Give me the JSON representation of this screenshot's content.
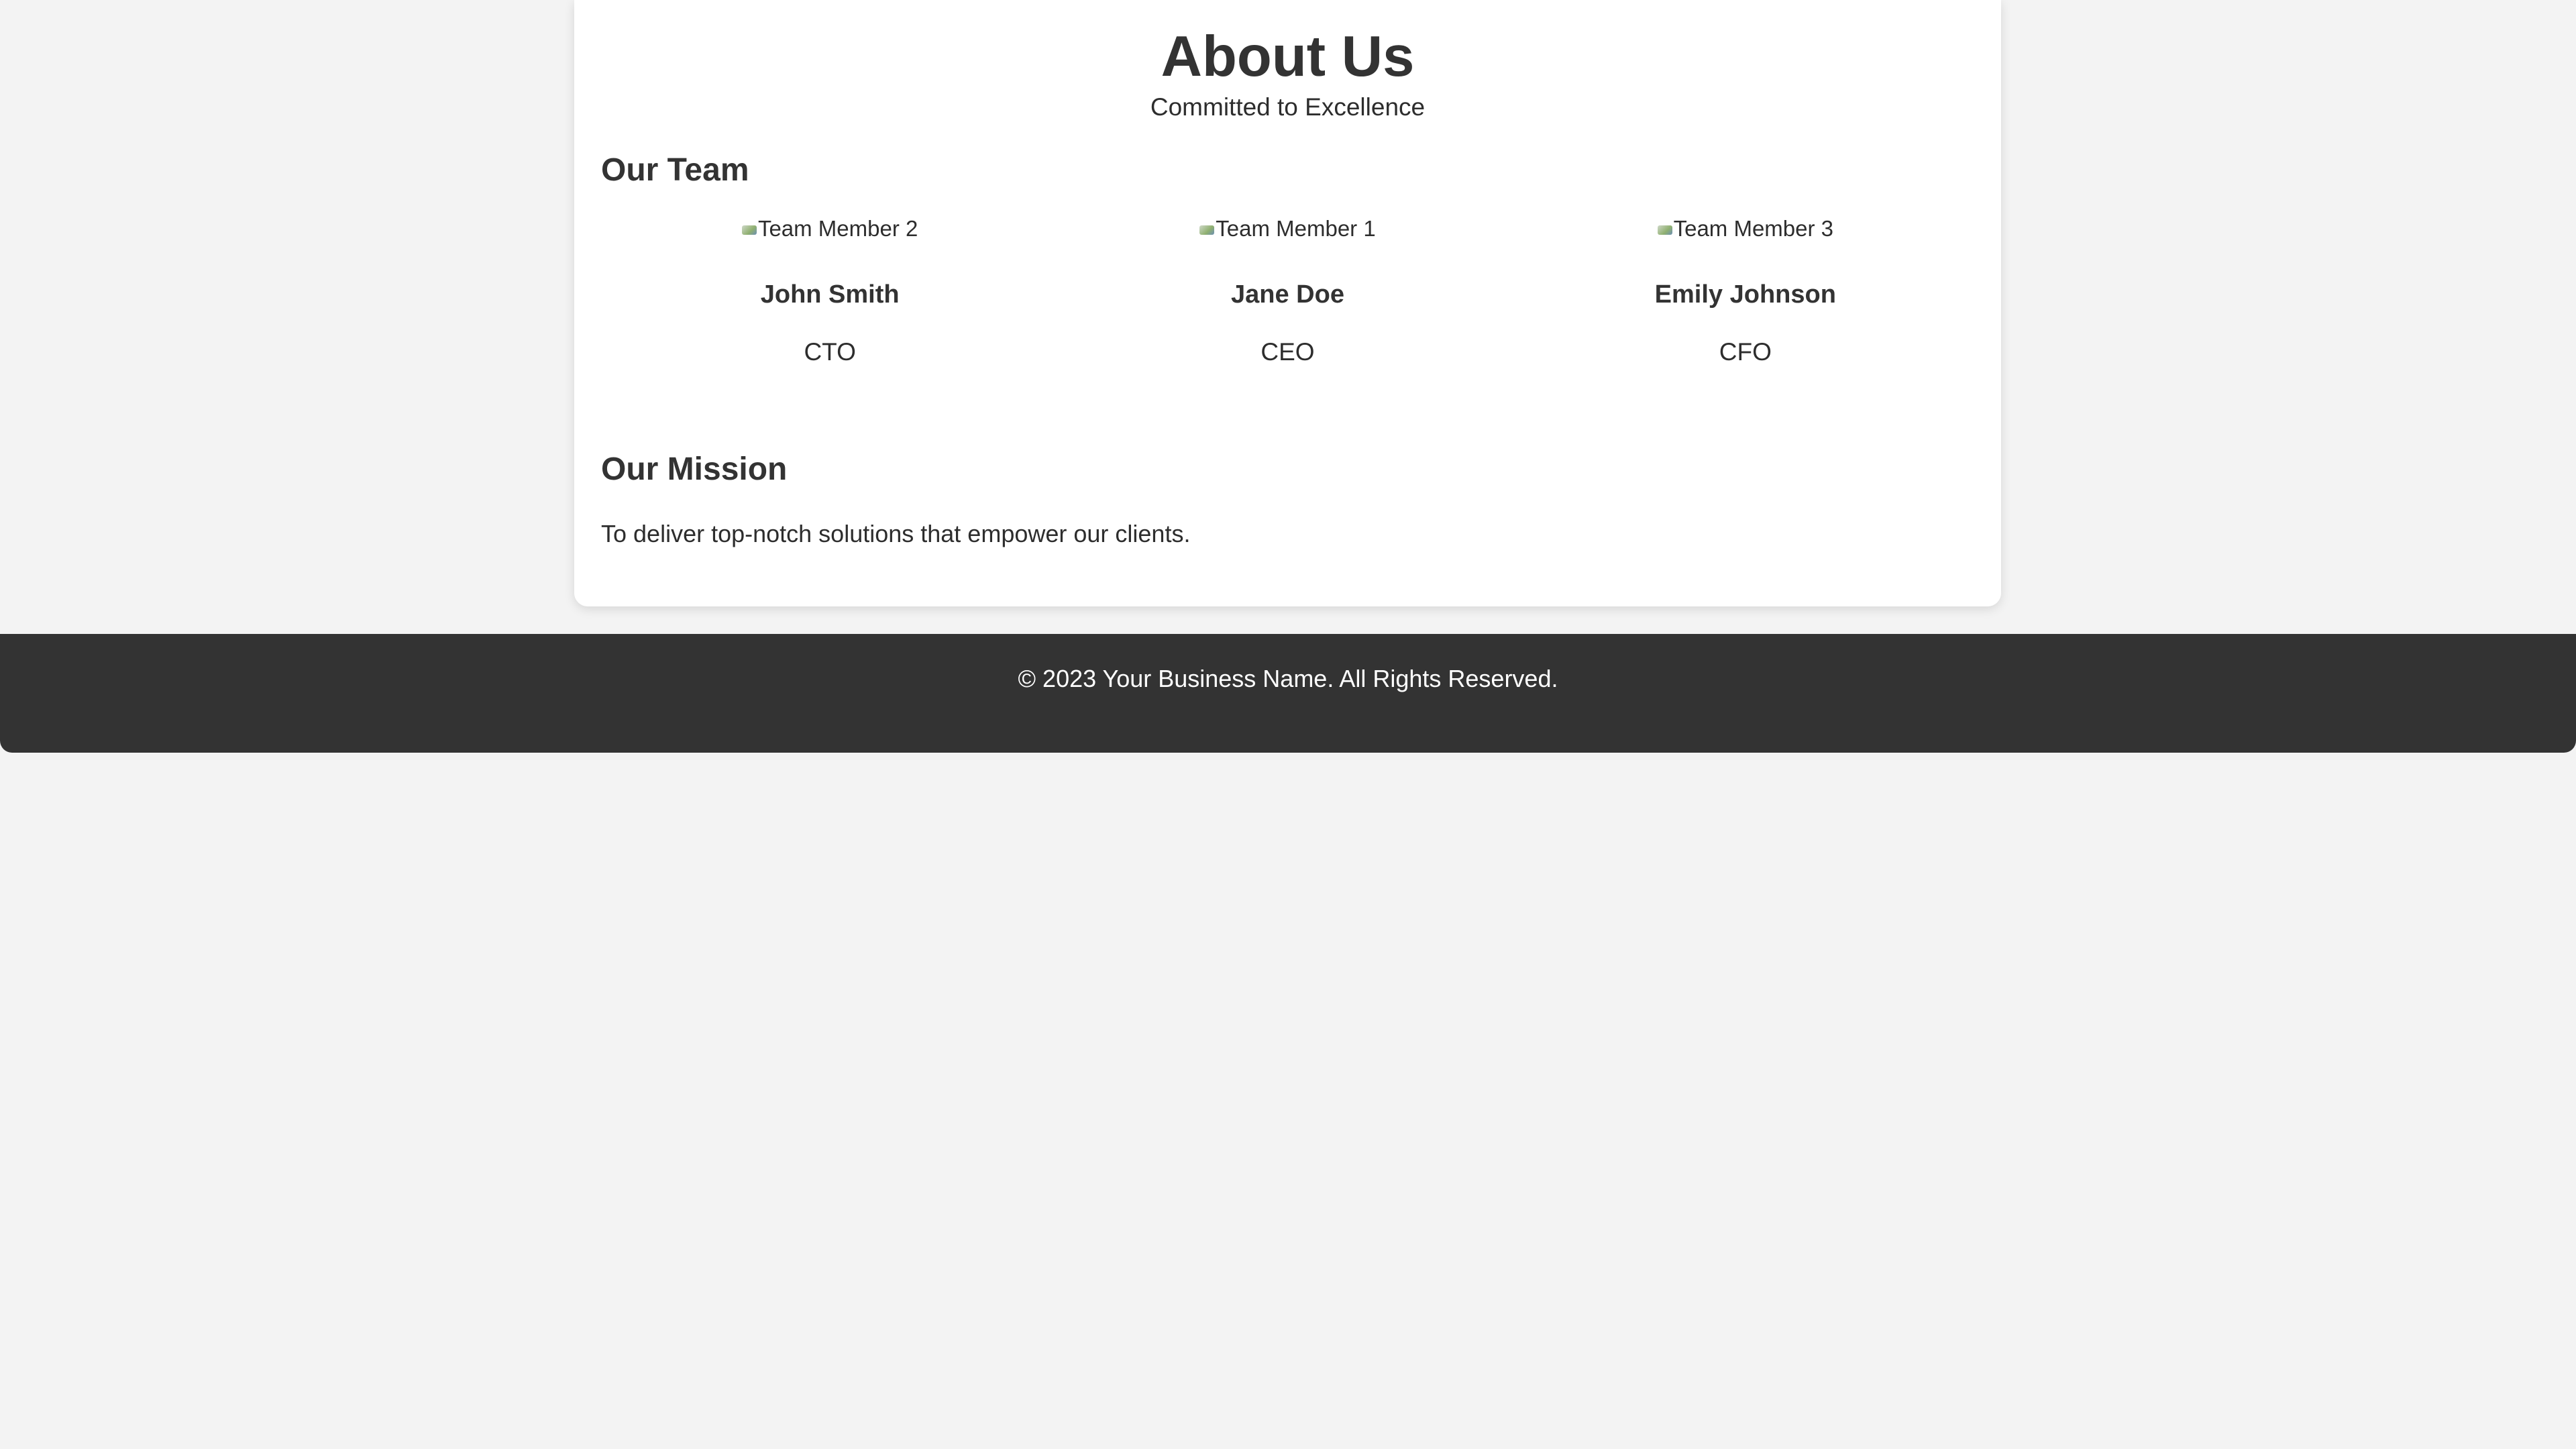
{
  "header": {
    "title": "About Us",
    "subtitle": "Committed to Excellence"
  },
  "team": {
    "heading": "Our Team",
    "members": [
      {
        "photo_alt": "Team Member 2",
        "name": "John Smith",
        "role": "CTO"
      },
      {
        "photo_alt": "Team Member 1",
        "name": "Jane Doe",
        "role": "CEO"
      },
      {
        "photo_alt": "Team Member 3",
        "name": "Emily Johnson",
        "role": "CFO"
      }
    ]
  },
  "mission": {
    "heading": "Our Mission",
    "text": "To deliver top-notch solutions that empower our clients."
  },
  "footer": {
    "text": "© 2023 Your Business Name. All Rights Reserved."
  },
  "colors": {
    "page_background": "#f3f3f3",
    "card_background": "#ffffff",
    "footer_background": "#333333",
    "footer_text": "#ffffff",
    "heading_text": "#333333"
  }
}
